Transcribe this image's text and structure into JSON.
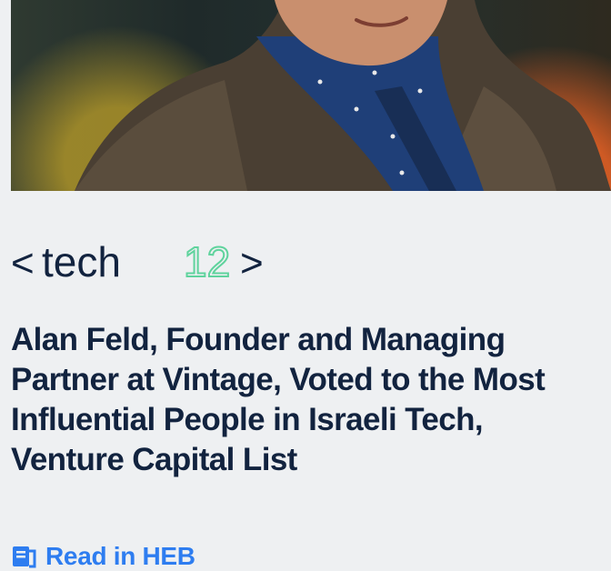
{
  "hero_image": {
    "subject": "portrait"
  },
  "logo": {
    "left_bracket": "<",
    "brand_text": "tech",
    "brand_number": "12",
    "right_bracket": ">",
    "number_color": "#5fd39d",
    "text_color": "#12233f"
  },
  "article": {
    "headline": "Alan Feld, Founder and Managing Partner at Vintage, Voted to the Most Influential People in Israeli Tech, Venture Capital List"
  },
  "read_link": {
    "label": "Read in HEB",
    "icon": "document-icon",
    "color": "#2e7df0"
  }
}
